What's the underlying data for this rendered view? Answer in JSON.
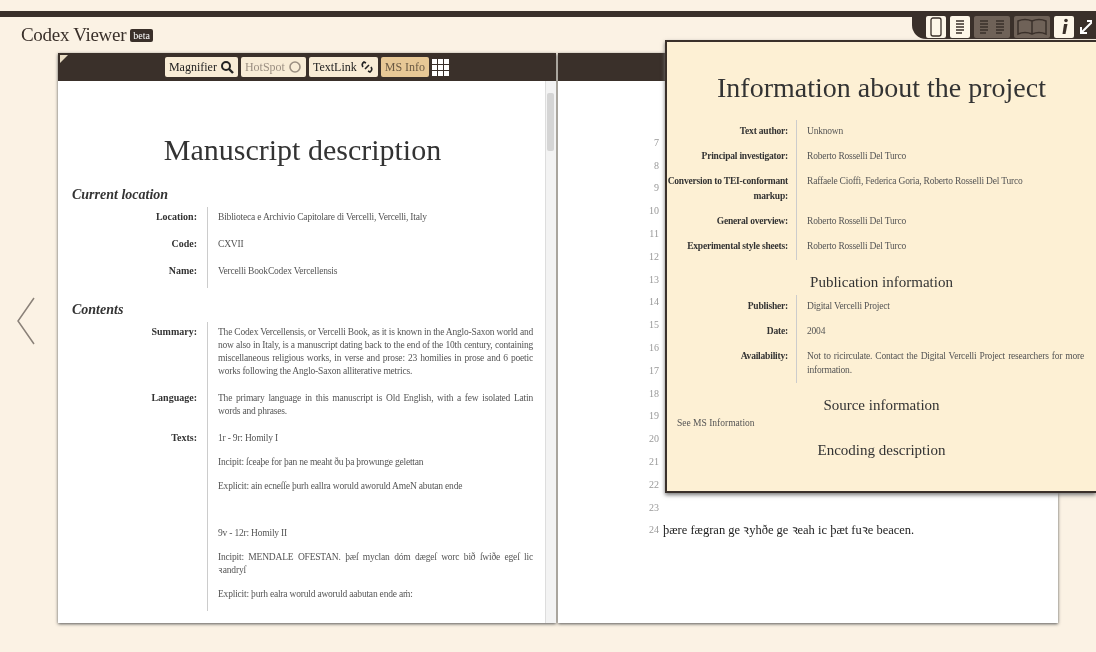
{
  "app": {
    "title": "Codex Viewer",
    "badge": "beta"
  },
  "view_modes": [
    {
      "kind": "image",
      "selected": true
    },
    {
      "kind": "text",
      "selected": true
    },
    {
      "kind": "double",
      "selected": false
    },
    {
      "kind": "book",
      "selected": false
    },
    {
      "kind": "info",
      "selected": true
    }
  ],
  "toolbar": {
    "buttons": [
      {
        "label": "Magnifier",
        "kind": "search",
        "disabled": false,
        "selected": false
      },
      {
        "label": "HotSpot",
        "kind": "circle",
        "disabled": true,
        "selected": false
      },
      {
        "label": "TextLink",
        "kind": "link",
        "disabled": false,
        "selected": false
      },
      {
        "label": "MS Info",
        "kind": "none",
        "disabled": false,
        "selected": true
      }
    ]
  },
  "ms_description": {
    "title": "Manuscript description",
    "sections": [
      {
        "heading": "Current location",
        "rows": [
          {
            "label": "Location:",
            "values": [
              "Biblioteca e Archivio Capitolare di Vercelli, Vercelli, Italy"
            ]
          },
          {
            "label": "Code:",
            "values": [
              "CXVII"
            ]
          },
          {
            "label": "Name:",
            "values": [
              "Vercelli BookCodex Vercellensis"
            ]
          }
        ]
      },
      {
        "heading": "Contents",
        "rows": [
          {
            "label": "Summary:",
            "values": [
              "The Codex Vercellensis, or Vercelli Book, as it is known in the Anglo-Saxon world and now also in Italy, is a manuscript dating back to the end of the 10th century, containing miscellaneous religious works, in verse and prose: 23 homilies in prose and 6 poetic works following the Anglo-Saxon alliterative metrics."
            ]
          },
          {
            "label": "Language:",
            "values": [
              "The primary language in this manuscript is Old English, with a few isolated Latin words and phrases."
            ]
          },
          {
            "label": "Texts:",
            "values": [
              "1r - 9r: Homily I",
              "Incipit: ſceaþe for þan ne meaht ðu þa þrowunge gelettan",
              "Explicit: ain ecneſſe þurh eallra woruld aworuld AmeN abutan ende",
              "9v - 12r: Homily II",
              "Incipit: MENDALE OFESTAN. þæſ myclan dóm dægeſ worc bið ſwiðe egeſ lic ꝛandryſ",
              "Explicit: þurh ealra woruld aworuld aabutan ende aṁ:"
            ]
          }
        ]
      }
    ]
  },
  "text_panel": {
    "line_numbers": [
      "7",
      "8",
      "9",
      "10",
      "11",
      "12",
      "13",
      "14",
      "15",
      "16",
      "17",
      "18",
      "19",
      "20",
      "21",
      "22",
      "23",
      "24"
    ],
    "last_line": "þære fægran ge ꝛyhðe ge ꝛeah ic þæt fuꝛe beacen."
  },
  "project_info": {
    "title": "Information about the project",
    "rows": [
      {
        "label": "Text author:",
        "value": "Unknown"
      },
      {
        "label": "Principal investigator:",
        "value": "Roberto Rosselli Del Turco"
      },
      {
        "label": "Conversion to TEI-conformant markup:",
        "value": "Raffaele Cioffi, Federica Goria, Roberto Rosselli Del Turco"
      },
      {
        "label": "General overview:",
        "value": "Roberto Rosselli Del Turco"
      },
      {
        "label": "Experimental style sheets:",
        "value": "Roberto Rosselli Del Turco"
      }
    ],
    "publication": {
      "heading": "Publication information",
      "rows": [
        {
          "label": "Publisher:",
          "value": "Digital Vercelli Project"
        },
        {
          "label": "Date:",
          "value": "2004"
        },
        {
          "label": "Availability:",
          "value": "Not to ricirculate. Contact the Digital Vercelli Project researchers for more information."
        }
      ]
    },
    "source": {
      "heading": "Source information",
      "note": "See MS Information"
    },
    "encoding": {
      "heading": "Encoding description"
    }
  }
}
